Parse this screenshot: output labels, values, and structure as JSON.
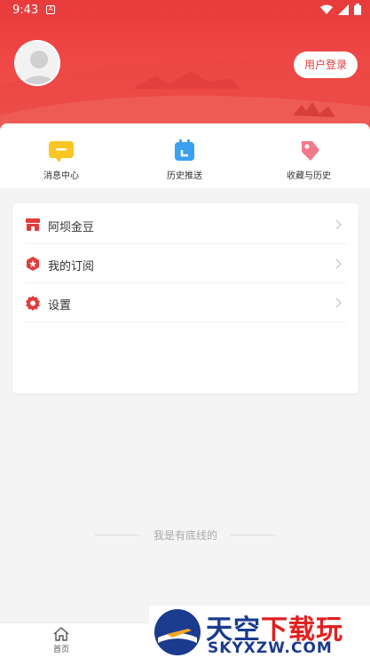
{
  "status_bar": {
    "time": "9:43",
    "notification_icon": "A"
  },
  "header": {
    "login_label": "用户登录",
    "accent_color": "#e83b3b"
  },
  "quick_actions": [
    {
      "label": "消息中心",
      "icon": "message-icon"
    },
    {
      "label": "历史推送",
      "icon": "calendar-icon"
    },
    {
      "label": "收藏与历史",
      "icon": "tag-icon"
    }
  ],
  "menu": [
    {
      "label": "阿坝金豆",
      "icon": "store-icon"
    },
    {
      "label": "我的订阅",
      "icon": "subscription-icon"
    },
    {
      "label": "设置",
      "icon": "settings-icon"
    }
  ],
  "footer_text": "我是有底线的",
  "tab_bar": {
    "home_label": "首页"
  },
  "watermark": {
    "title_part1": "天空",
    "title_part2": "下载玩",
    "subtitle": "SKYXZW.COM"
  }
}
